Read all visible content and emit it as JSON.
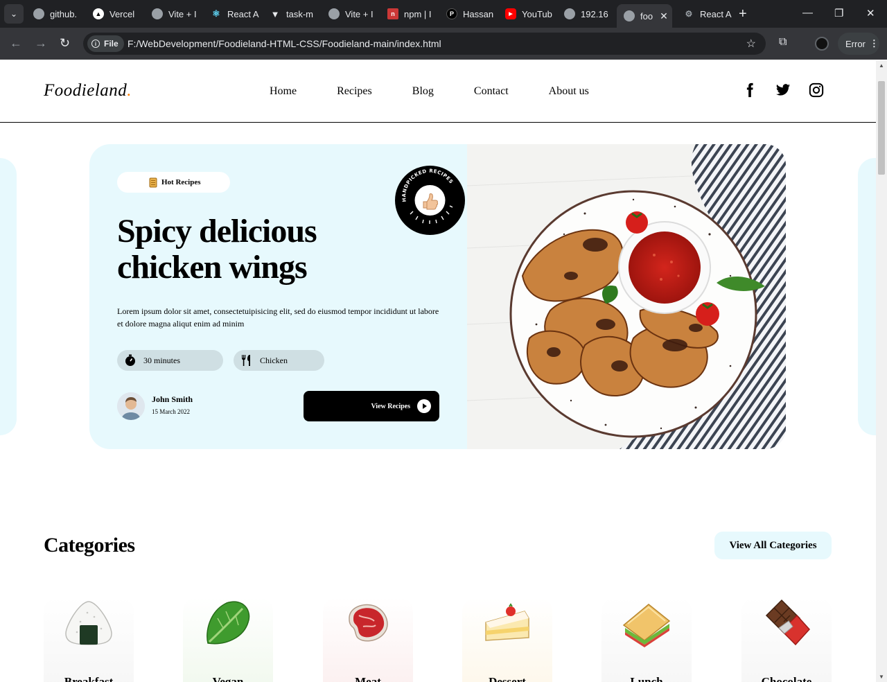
{
  "browser": {
    "tabs": [
      {
        "label": "github.",
        "favicon": "globe-icon"
      },
      {
        "label": "Vercel",
        "favicon": "vercel-icon"
      },
      {
        "label": "Vite + I",
        "favicon": "globe-icon"
      },
      {
        "label": "React A",
        "favicon": "react-icon"
      },
      {
        "label": "task-m",
        "favicon": "vite-icon"
      },
      {
        "label": "Vite + I",
        "favicon": "globe-icon"
      },
      {
        "label": "npm | I",
        "favicon": "npm-icon"
      },
      {
        "label": "Hassan",
        "favicon": "p-icon"
      },
      {
        "label": "YouTub",
        "favicon": "youtube-icon"
      },
      {
        "label": "192.16",
        "favicon": "globe-icon"
      },
      {
        "label": "foo",
        "favicon": "globe-icon",
        "active": true
      },
      {
        "label": "React A",
        "favicon": "react-gray-icon"
      }
    ],
    "omnibox": {
      "chip": "File",
      "url": "F:/WebDevelopment/Foodieland-HTML-CSS/Foodieland-main/index.html"
    },
    "error_button": "Error"
  },
  "site": {
    "logo": "Foodieland",
    "logo_dot": ".",
    "nav": [
      "Home",
      "Recipes",
      "Blog",
      "Contact",
      "About us"
    ],
    "social": [
      "facebook-icon",
      "twitter-icon",
      "instagram-icon"
    ]
  },
  "hero": {
    "chip": "Hot Recipes",
    "title_line1": "Spicy delicious",
    "title_line2": "chicken wings",
    "description": "Lorem ipsum dolor sit amet, consectetuipisicing elit, sed do eiusmod tempor incididunt ut labore et dolore magna aliqut enim ad minim",
    "time": "30 minutes",
    "category": "Chicken",
    "author": "John Smith",
    "date": "15 March 2022",
    "button": "View Recipes",
    "badge_text": "HANDPICKED RECIPES"
  },
  "categories": {
    "title": "Categories",
    "button": "View All Categories",
    "items": [
      {
        "label": "Breakfast",
        "icon": "onigiri-icon",
        "tint": "#f5f5f5"
      },
      {
        "label": "Vegan",
        "icon": "lettuce-icon",
        "tint": "#eef7ea"
      },
      {
        "label": "Meat",
        "icon": "steak-icon",
        "tint": "#fbecec"
      },
      {
        "label": "Dessert",
        "icon": "cake-icon",
        "tint": "#fdf6e6"
      },
      {
        "label": "Lunch",
        "icon": "sandwich-icon",
        "tint": "#f5f5f5"
      },
      {
        "label": "Chocolate",
        "icon": "chocolate-icon",
        "tint": "#f5f5f5"
      }
    ]
  }
}
